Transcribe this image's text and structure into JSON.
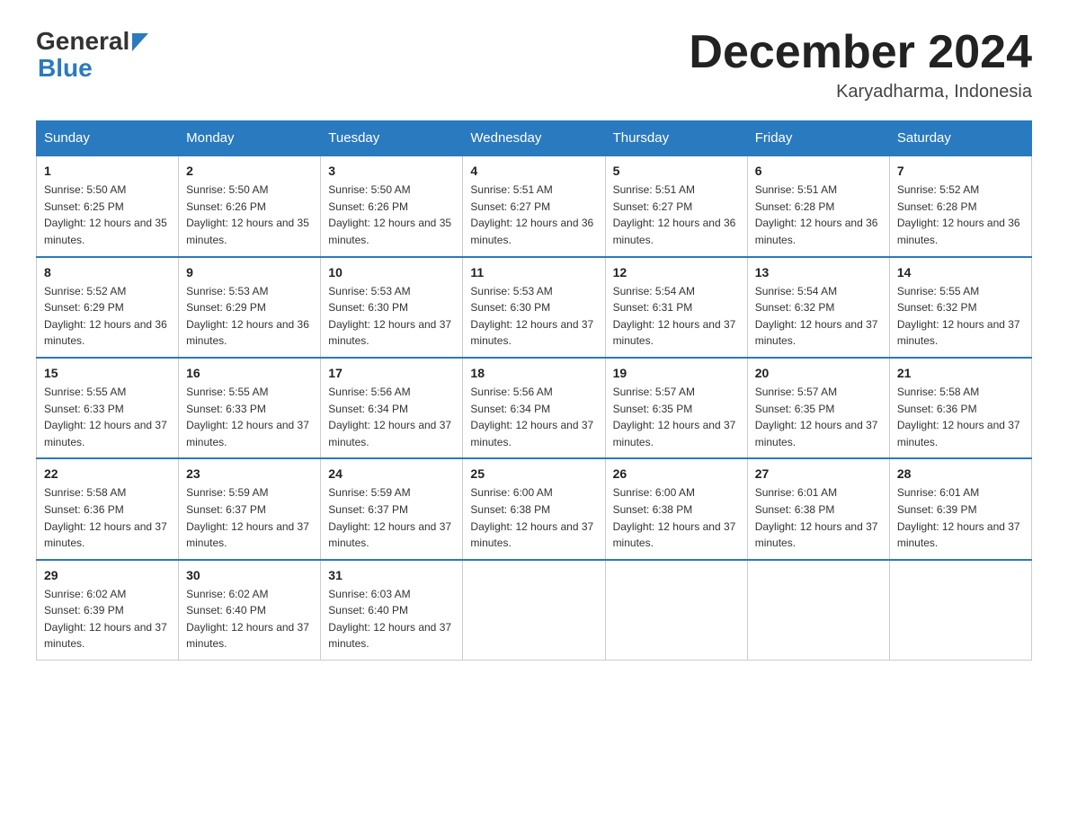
{
  "header": {
    "logo_general": "General",
    "logo_blue": "Blue",
    "title": "December 2024",
    "location": "Karyadharma, Indonesia"
  },
  "days_of_week": [
    "Sunday",
    "Monday",
    "Tuesday",
    "Wednesday",
    "Thursday",
    "Friday",
    "Saturday"
  ],
  "weeks": [
    [
      {
        "day": "1",
        "sunrise": "5:50 AM",
        "sunset": "6:25 PM",
        "daylight": "12 hours and 35 minutes."
      },
      {
        "day": "2",
        "sunrise": "5:50 AM",
        "sunset": "6:26 PM",
        "daylight": "12 hours and 35 minutes."
      },
      {
        "day": "3",
        "sunrise": "5:50 AM",
        "sunset": "6:26 PM",
        "daylight": "12 hours and 35 minutes."
      },
      {
        "day": "4",
        "sunrise": "5:51 AM",
        "sunset": "6:27 PM",
        "daylight": "12 hours and 36 minutes."
      },
      {
        "day": "5",
        "sunrise": "5:51 AM",
        "sunset": "6:27 PM",
        "daylight": "12 hours and 36 minutes."
      },
      {
        "day": "6",
        "sunrise": "5:51 AM",
        "sunset": "6:28 PM",
        "daylight": "12 hours and 36 minutes."
      },
      {
        "day": "7",
        "sunrise": "5:52 AM",
        "sunset": "6:28 PM",
        "daylight": "12 hours and 36 minutes."
      }
    ],
    [
      {
        "day": "8",
        "sunrise": "5:52 AM",
        "sunset": "6:29 PM",
        "daylight": "12 hours and 36 minutes."
      },
      {
        "day": "9",
        "sunrise": "5:53 AM",
        "sunset": "6:29 PM",
        "daylight": "12 hours and 36 minutes."
      },
      {
        "day": "10",
        "sunrise": "5:53 AM",
        "sunset": "6:30 PM",
        "daylight": "12 hours and 37 minutes."
      },
      {
        "day": "11",
        "sunrise": "5:53 AM",
        "sunset": "6:30 PM",
        "daylight": "12 hours and 37 minutes."
      },
      {
        "day": "12",
        "sunrise": "5:54 AM",
        "sunset": "6:31 PM",
        "daylight": "12 hours and 37 minutes."
      },
      {
        "day": "13",
        "sunrise": "5:54 AM",
        "sunset": "6:32 PM",
        "daylight": "12 hours and 37 minutes."
      },
      {
        "day": "14",
        "sunrise": "5:55 AM",
        "sunset": "6:32 PM",
        "daylight": "12 hours and 37 minutes."
      }
    ],
    [
      {
        "day": "15",
        "sunrise": "5:55 AM",
        "sunset": "6:33 PM",
        "daylight": "12 hours and 37 minutes."
      },
      {
        "day": "16",
        "sunrise": "5:55 AM",
        "sunset": "6:33 PM",
        "daylight": "12 hours and 37 minutes."
      },
      {
        "day": "17",
        "sunrise": "5:56 AM",
        "sunset": "6:34 PM",
        "daylight": "12 hours and 37 minutes."
      },
      {
        "day": "18",
        "sunrise": "5:56 AM",
        "sunset": "6:34 PM",
        "daylight": "12 hours and 37 minutes."
      },
      {
        "day": "19",
        "sunrise": "5:57 AM",
        "sunset": "6:35 PM",
        "daylight": "12 hours and 37 minutes."
      },
      {
        "day": "20",
        "sunrise": "5:57 AM",
        "sunset": "6:35 PM",
        "daylight": "12 hours and 37 minutes."
      },
      {
        "day": "21",
        "sunrise": "5:58 AM",
        "sunset": "6:36 PM",
        "daylight": "12 hours and 37 minutes."
      }
    ],
    [
      {
        "day": "22",
        "sunrise": "5:58 AM",
        "sunset": "6:36 PM",
        "daylight": "12 hours and 37 minutes."
      },
      {
        "day": "23",
        "sunrise": "5:59 AM",
        "sunset": "6:37 PM",
        "daylight": "12 hours and 37 minutes."
      },
      {
        "day": "24",
        "sunrise": "5:59 AM",
        "sunset": "6:37 PM",
        "daylight": "12 hours and 37 minutes."
      },
      {
        "day": "25",
        "sunrise": "6:00 AM",
        "sunset": "6:38 PM",
        "daylight": "12 hours and 37 minutes."
      },
      {
        "day": "26",
        "sunrise": "6:00 AM",
        "sunset": "6:38 PM",
        "daylight": "12 hours and 37 minutes."
      },
      {
        "day": "27",
        "sunrise": "6:01 AM",
        "sunset": "6:38 PM",
        "daylight": "12 hours and 37 minutes."
      },
      {
        "day": "28",
        "sunrise": "6:01 AM",
        "sunset": "6:39 PM",
        "daylight": "12 hours and 37 minutes."
      }
    ],
    [
      {
        "day": "29",
        "sunrise": "6:02 AM",
        "sunset": "6:39 PM",
        "daylight": "12 hours and 37 minutes."
      },
      {
        "day": "30",
        "sunrise": "6:02 AM",
        "sunset": "6:40 PM",
        "daylight": "12 hours and 37 minutes."
      },
      {
        "day": "31",
        "sunrise": "6:03 AM",
        "sunset": "6:40 PM",
        "daylight": "12 hours and 37 minutes."
      },
      null,
      null,
      null,
      null
    ]
  ]
}
